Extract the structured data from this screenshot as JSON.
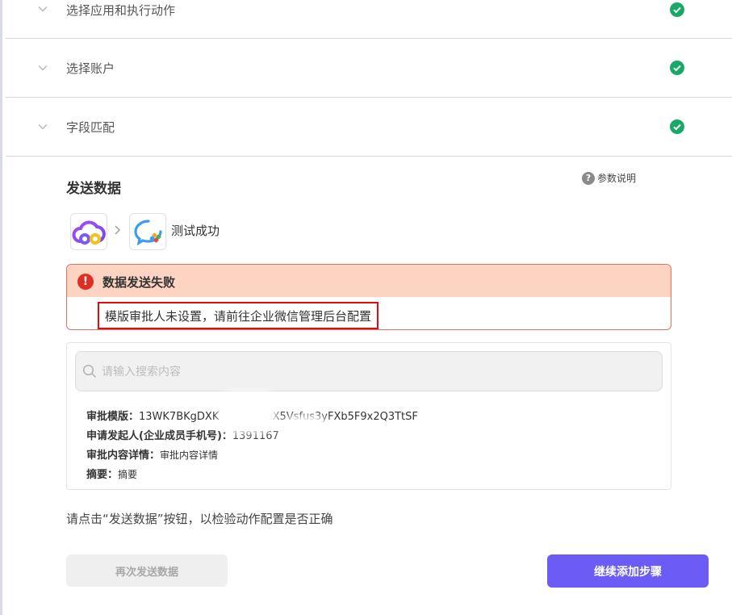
{
  "accordion": [
    {
      "label": "选择应用和执行动作",
      "status": "complete"
    },
    {
      "label": "选择账户",
      "status": "complete"
    },
    {
      "label": "字段匹配",
      "status": "complete"
    }
  ],
  "send_section": {
    "title": "发送数据",
    "help_label": "参数说明",
    "test_status": "测试成功"
  },
  "alert": {
    "title": "数据发送失败",
    "message": "模版审批人未设置，请前往企业微信管理后台配置"
  },
  "search": {
    "placeholder": "请输入搜索内容",
    "value": ""
  },
  "fields": [
    {
      "key": "审批模版：",
      "value": "13WK7BKgDXK",
      "value_tail": "nX5Vsfus3yFXb5F9x2Q3TtSF"
    },
    {
      "key": "申请发起人(企业成员手机号)：",
      "value": "1391167"
    },
    {
      "key": "审批内容详情：",
      "value": "审批内容详情"
    },
    {
      "key": "摘要：",
      "value": "摘要"
    }
  ],
  "hint": "请点击“发送数据”按钮，以检验动作配置是否正确",
  "buttons": {
    "resend": "再次发送数据",
    "continue": "继续添加步骤"
  },
  "colors": {
    "success": "#18a966",
    "error": "#e02e24",
    "alert_bg": "#fdd3c2",
    "primary": "#6a5cf4",
    "highlight_box": "#e30b0b"
  },
  "icons": {
    "source_app": "cloud-app-icon",
    "target_app": "wecom-icon",
    "status": "check-circle-icon",
    "collapse": "chevron-down-icon"
  }
}
